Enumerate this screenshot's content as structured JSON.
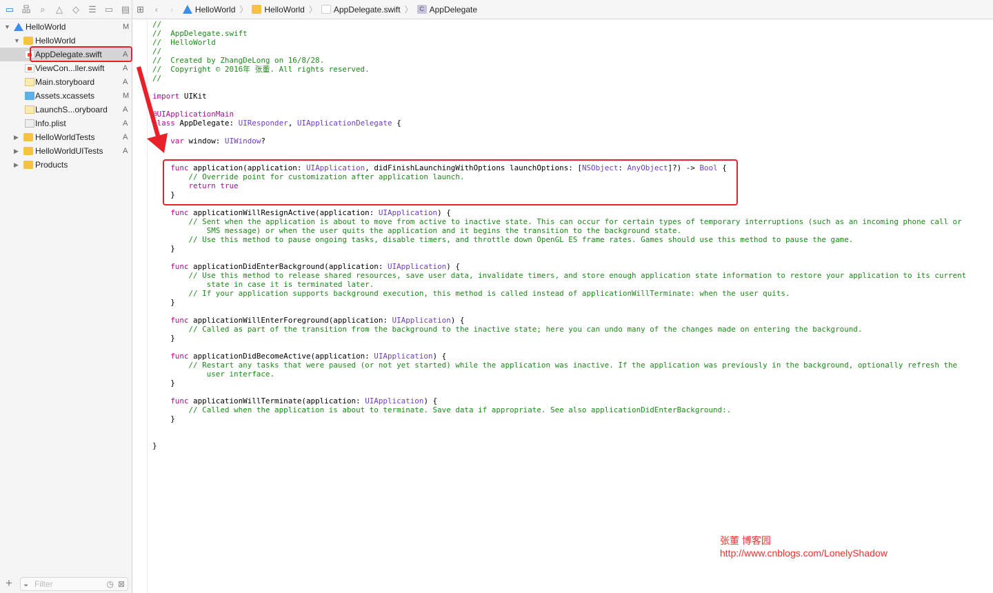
{
  "toolbar": {
    "nav_icons": [
      "folder-icon",
      "hierarchy-icon",
      "search-icon",
      "warning-icon",
      "test-icon",
      "debug-icon",
      "breakpoint-icon",
      "report-icon"
    ],
    "breadcrumb": [
      "HelloWorld",
      "HelloWorld",
      "AppDelegate.swift",
      "AppDelegate"
    ]
  },
  "sidebar": {
    "items": [
      {
        "label": "HelloWorld",
        "status": "M",
        "kind": "project",
        "level": 0,
        "expanded": true
      },
      {
        "label": "HelloWorld",
        "status": "",
        "kind": "folder",
        "level": 1,
        "expanded": true
      },
      {
        "label": "AppDelegate.swift",
        "status": "A",
        "kind": "swift",
        "level": 2,
        "selected": true
      },
      {
        "label": "ViewCon...ller.swift",
        "status": "A",
        "kind": "swift",
        "level": 2
      },
      {
        "label": "Main.storyboard",
        "status": "A",
        "kind": "storyboard",
        "level": 2
      },
      {
        "label": "Assets.xcassets",
        "status": "M",
        "kind": "assets",
        "level": 2
      },
      {
        "label": "LaunchS...oryboard",
        "status": "A",
        "kind": "storyboard",
        "level": 2
      },
      {
        "label": "Info.plist",
        "status": "A",
        "kind": "plist",
        "level": 2
      },
      {
        "label": "HelloWorldTests",
        "status": "A",
        "kind": "folder",
        "level": 1,
        "expanded": false
      },
      {
        "label": "HelloWorldUITests",
        "status": "A",
        "kind": "folder",
        "level": 1,
        "expanded": false
      },
      {
        "label": "Products",
        "status": "",
        "kind": "folder",
        "level": 1,
        "expanded": false
      }
    ],
    "filter_placeholder": "Filter"
  },
  "code": [
    [
      [
        "c",
        "//"
      ]
    ],
    [
      [
        "c",
        "//  AppDelegate.swift"
      ]
    ],
    [
      [
        "c",
        "//  HelloWorld"
      ]
    ],
    [
      [
        "c",
        "//"
      ]
    ],
    [
      [
        "c",
        "//  Created by ZhangDeLong on 16/8/28."
      ]
    ],
    [
      [
        "c",
        "//  Copyright © 2016年 张董. All rights reserved."
      ]
    ],
    [
      [
        "c",
        "//"
      ]
    ],
    [],
    [
      [
        "k",
        "import"
      ],
      [
        "p",
        " UIKit"
      ]
    ],
    [],
    [
      [
        "k",
        "@UIApplicationMain"
      ]
    ],
    [
      [
        "k",
        "class"
      ],
      [
        "p",
        " AppDelegate: "
      ],
      [
        "t",
        "UIResponder"
      ],
      [
        "p",
        ", "
      ],
      [
        "t",
        "UIApplicationDelegate"
      ],
      [
        "p",
        " {"
      ]
    ],
    [],
    [
      [
        "p",
        "    "
      ],
      [
        "k",
        "var"
      ],
      [
        "p",
        " window: "
      ],
      [
        "t",
        "UIWindow"
      ],
      [
        "p",
        "?"
      ]
    ],
    [],
    [],
    [
      [
        "p",
        "    "
      ],
      [
        "k",
        "func"
      ],
      [
        "p",
        " application(application: "
      ],
      [
        "t",
        "UIApplication"
      ],
      [
        "p",
        ", didFinishLaunchingWithOptions launchOptions: ["
      ],
      [
        "t",
        "NSObject"
      ],
      [
        "p",
        ": "
      ],
      [
        "t",
        "AnyObject"
      ],
      [
        "p",
        "]?) -> "
      ],
      [
        "t",
        "Bool"
      ],
      [
        "p",
        " {"
      ]
    ],
    [
      [
        "p",
        "        "
      ],
      [
        "c",
        "// Override point for customization after application launch."
      ]
    ],
    [
      [
        "p",
        "        "
      ],
      [
        "k",
        "return"
      ],
      [
        "p",
        " "
      ],
      [
        "k",
        "true"
      ]
    ],
    [
      [
        "p",
        "    }"
      ]
    ],
    [],
    [
      [
        "p",
        "    "
      ],
      [
        "k",
        "func"
      ],
      [
        "p",
        " applicationWillResignActive(application: "
      ],
      [
        "t",
        "UIApplication"
      ],
      [
        "p",
        ") {"
      ]
    ],
    [
      [
        "p",
        "        "
      ],
      [
        "c",
        "// Sent when the application is about to move from active to inactive state. This can occur for certain types of temporary interruptions (such as an incoming phone call or"
      ]
    ],
    [
      [
        "c",
        "            SMS message) or when the user quits the application and it begins the transition to the background state."
      ]
    ],
    [
      [
        "p",
        "        "
      ],
      [
        "c",
        "// Use this method to pause ongoing tasks, disable timers, and throttle down OpenGL ES frame rates. Games should use this method to pause the game."
      ]
    ],
    [
      [
        "p",
        "    }"
      ]
    ],
    [],
    [
      [
        "p",
        "    "
      ],
      [
        "k",
        "func"
      ],
      [
        "p",
        " applicationDidEnterBackground(application: "
      ],
      [
        "t",
        "UIApplication"
      ],
      [
        "p",
        ") {"
      ]
    ],
    [
      [
        "p",
        "        "
      ],
      [
        "c",
        "// Use this method to release shared resources, save user data, invalidate timers, and store enough application state information to restore your application to its current"
      ]
    ],
    [
      [
        "c",
        "            state in case it is terminated later."
      ]
    ],
    [
      [
        "p",
        "        "
      ],
      [
        "c",
        "// If your application supports background execution, this method is called instead of applicationWillTerminate: when the user quits."
      ]
    ],
    [
      [
        "p",
        "    }"
      ]
    ],
    [],
    [
      [
        "p",
        "    "
      ],
      [
        "k",
        "func"
      ],
      [
        "p",
        " applicationWillEnterForeground(application: "
      ],
      [
        "t",
        "UIApplication"
      ],
      [
        "p",
        ") {"
      ]
    ],
    [
      [
        "p",
        "        "
      ],
      [
        "c",
        "// Called as part of the transition from the background to the inactive state; here you can undo many of the changes made on entering the background."
      ]
    ],
    [
      [
        "p",
        "    }"
      ]
    ],
    [],
    [
      [
        "p",
        "    "
      ],
      [
        "k",
        "func"
      ],
      [
        "p",
        " applicationDidBecomeActive(application: "
      ],
      [
        "t",
        "UIApplication"
      ],
      [
        "p",
        ") {"
      ]
    ],
    [
      [
        "p",
        "        "
      ],
      [
        "c",
        "// Restart any tasks that were paused (or not yet started) while the application was inactive. If the application was previously in the background, optionally refresh the"
      ]
    ],
    [
      [
        "c",
        "            user interface."
      ]
    ],
    [
      [
        "p",
        "    }"
      ]
    ],
    [],
    [
      [
        "p",
        "    "
      ],
      [
        "k",
        "func"
      ],
      [
        "p",
        " applicationWillTerminate(application: "
      ],
      [
        "t",
        "UIApplication"
      ],
      [
        "p",
        ") {"
      ]
    ],
    [
      [
        "p",
        "        "
      ],
      [
        "c",
        "// Called when the application is about to terminate. Save data if appropriate. See also applicationDidEnterBackground:."
      ]
    ],
    [
      [
        "p",
        "    }"
      ]
    ],
    [],
    [],
    [
      [
        "p",
        "}"
      ]
    ]
  ],
  "watermark": {
    "line1": "张董 博客园",
    "line2": "http://www.cnblogs.com/LonelyShadow"
  },
  "colors": {
    "highlight": "#e8202a",
    "comment": "#1d8a1a",
    "keyword": "#aa0d91",
    "type": "#6f3ec2"
  }
}
